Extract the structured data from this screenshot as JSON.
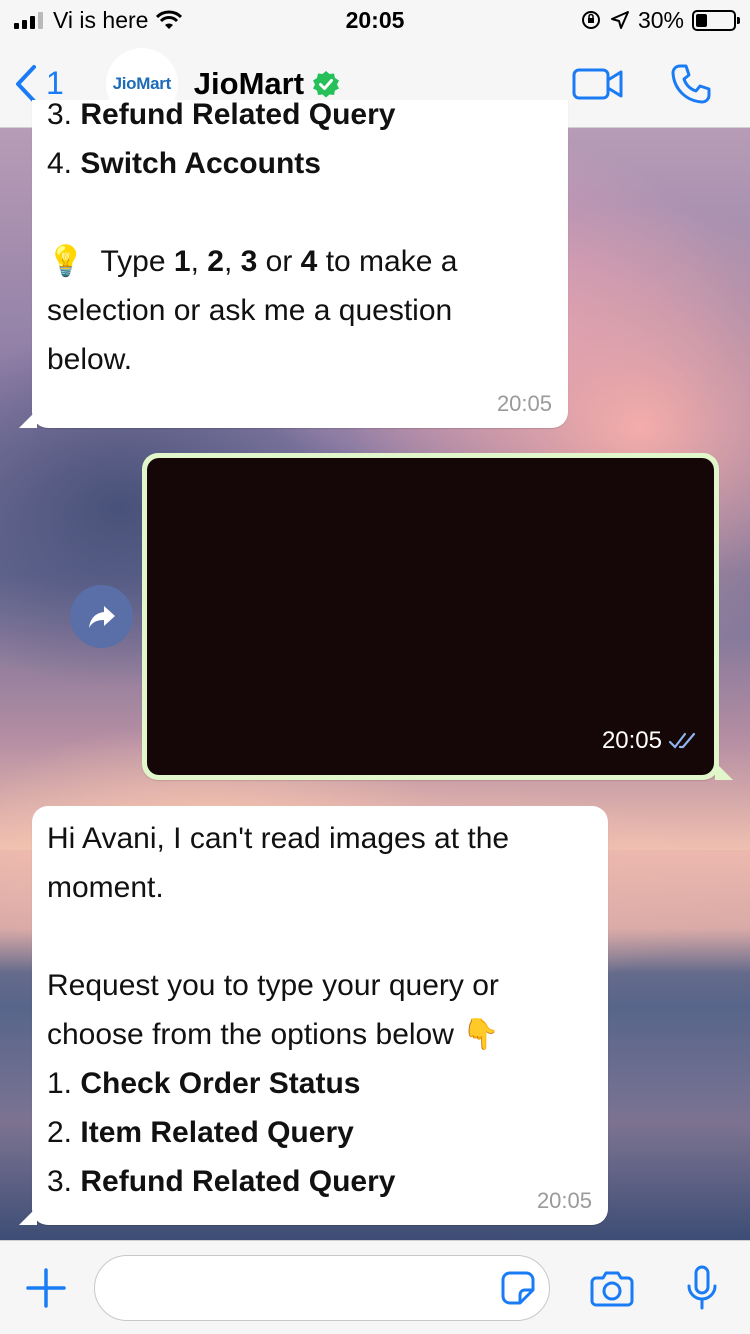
{
  "status_bar": {
    "carrier": "Vi is here",
    "time": "20:05",
    "battery_percent": "30%",
    "battery_level": 0.3,
    "icons": [
      "signal-icon",
      "wifi-icon",
      "orientation-lock-icon",
      "location-icon",
      "battery-icon"
    ]
  },
  "header": {
    "back_count": "1",
    "avatar_text": "JioMart",
    "contact_name": "JioMart",
    "verified_icon": "verified-badge-icon",
    "actions": [
      "video-call-icon",
      "voice-call-icon"
    ]
  },
  "messages": {
    "m1": {
      "line1_num": "3.",
      "line1_text": "Refund Related Query",
      "line2_num": "4.",
      "line2_text": "Switch Accounts",
      "tip_emoji": "💡",
      "tip_type": "Type",
      "tip_1": "1",
      "tip_2": "2",
      "tip_3": "3",
      "tip_or": "or",
      "tip_4": "4",
      "tip_rest": "to make a",
      "tip_line2": "selection or ask me a question",
      "tip_line3": "below.",
      "time": "20:05"
    },
    "m2": {
      "type": "image",
      "time": "20:05",
      "status_icon": "double-check-icon"
    },
    "m3": {
      "line1": "Hi Avani, I can't read images at the",
      "line2": "moment.",
      "line3": "Request you to type your query or",
      "line4": "choose from the options below",
      "line4_emoji": "👇",
      "opt1_num": "1.",
      "opt1": "Check Order Status",
      "opt2_num": "2.",
      "opt2": "Item Related Query",
      "opt3_num": "3.",
      "opt3": "Refund Related Query",
      "time": "20:05"
    }
  },
  "input_bar": {
    "placeholder": "",
    "icons": [
      "plus-icon",
      "sticker-icon",
      "camera-icon",
      "microphone-icon"
    ]
  },
  "colors": {
    "accent": "#1a7cf5",
    "verified": "#25c05a",
    "outgoing_bubble": "#e2f6cb",
    "incoming_bubble": "#ffffff"
  }
}
